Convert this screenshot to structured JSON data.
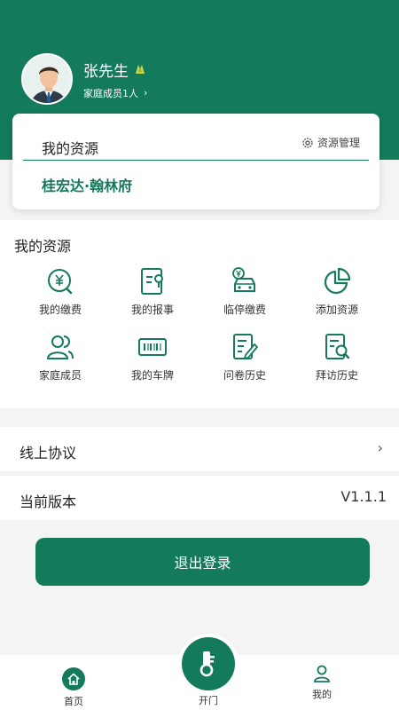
{
  "colors": {
    "brand": "#147a5c",
    "background": "#f4f4f4"
  },
  "profile": {
    "name": "张先生",
    "family_members": "家庭成员1人",
    "avatar_icon": "user-avatar",
    "badge_icon": "verified-badge-icon"
  },
  "resource_card": {
    "title": "我的资源",
    "manage_label": "资源管理",
    "property": "桂宏达·翰林府"
  },
  "services": {
    "title": "我的资源",
    "items": [
      {
        "label": "我的缴费",
        "icon": "yuan-search-icon"
      },
      {
        "label": "我的报事",
        "icon": "report-doc-icon"
      },
      {
        "label": "临停缴费",
        "icon": "car-yuan-icon"
      },
      {
        "label": "添加资源",
        "icon": "pie-chart-icon"
      },
      {
        "label": "家庭成员",
        "icon": "family-icon"
      },
      {
        "label": "我的车牌",
        "icon": "license-plate-icon"
      },
      {
        "label": "问卷历史",
        "icon": "survey-icon"
      },
      {
        "label": "拜访历史",
        "icon": "visit-history-icon"
      }
    ]
  },
  "settings": {
    "agreement_label": "线上协议",
    "version_label": "当前版本",
    "version_value": "V1.1.1"
  },
  "logout_label": "退出登录",
  "bottom_nav": {
    "home": "首页",
    "open": "开门",
    "mine": "我的"
  }
}
